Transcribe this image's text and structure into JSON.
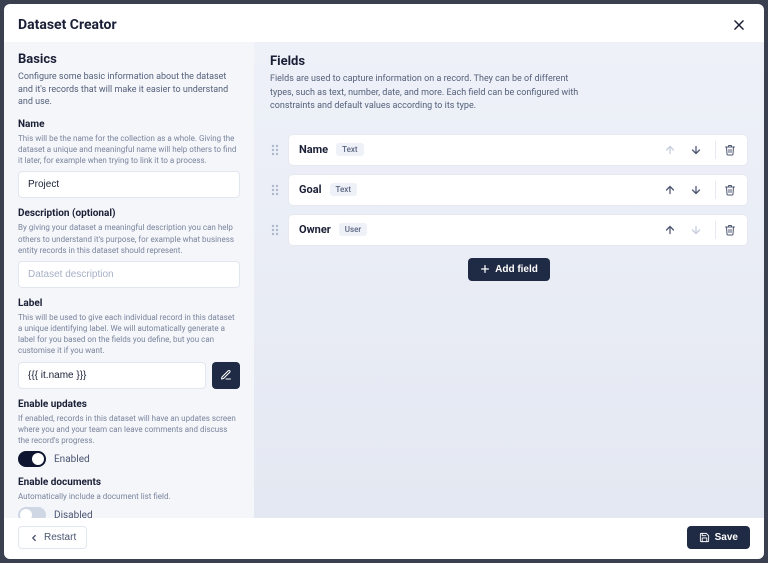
{
  "modal": {
    "title": "Dataset Creator",
    "basics": {
      "heading": "Basics",
      "subheading": "Configure some basic information about the dataset and it's records that will make it easier to understand and use.",
      "name": {
        "label": "Name",
        "help": "This will be the name for the collection as a whole. Giving the dataset a unique and meaningful name will help others to find it later, for example when trying to link it to a process.",
        "value": "Project"
      },
      "description": {
        "label": "Description (optional)",
        "help": "By giving your dataset a meaningful description you can help others to understand it's purpose, for example what business entity records in this dataset should represent.",
        "placeholder": "Dataset description",
        "value": ""
      },
      "recordLabel": {
        "label": "Label",
        "help": "This will be used to give each individual record in this dataset a unique identifying label. We will automatically generate a label for you based on the fields you define, but you can customise it if you want.",
        "value": "{{{ it.name }}}"
      },
      "enableUpdates": {
        "label": "Enable updates",
        "help": "If enabled, records in this dataset will have an updates screen where you and your team can leave comments and discuss the record's progress.",
        "status": "Enabled",
        "on": true
      },
      "enableDocuments": {
        "label": "Enable documents",
        "help": "Automatically include a document list field.",
        "status": "Disabled",
        "on": false
      }
    },
    "fields": {
      "heading": "Fields",
      "subheading": "Fields are used to capture information on a record. They can be of different types, such as text, number, date, and more. Each field can be configured with constraints and default values according to its type.",
      "items": [
        {
          "name": "Name",
          "type": "Text",
          "upDisabled": true,
          "downDisabled": false
        },
        {
          "name": "Goal",
          "type": "Text",
          "upDisabled": false,
          "downDisabled": false
        },
        {
          "name": "Owner",
          "type": "User",
          "upDisabled": false,
          "downDisabled": true
        }
      ],
      "addLabel": "Add field"
    },
    "footer": {
      "restart": "Restart",
      "save": "Save"
    }
  }
}
